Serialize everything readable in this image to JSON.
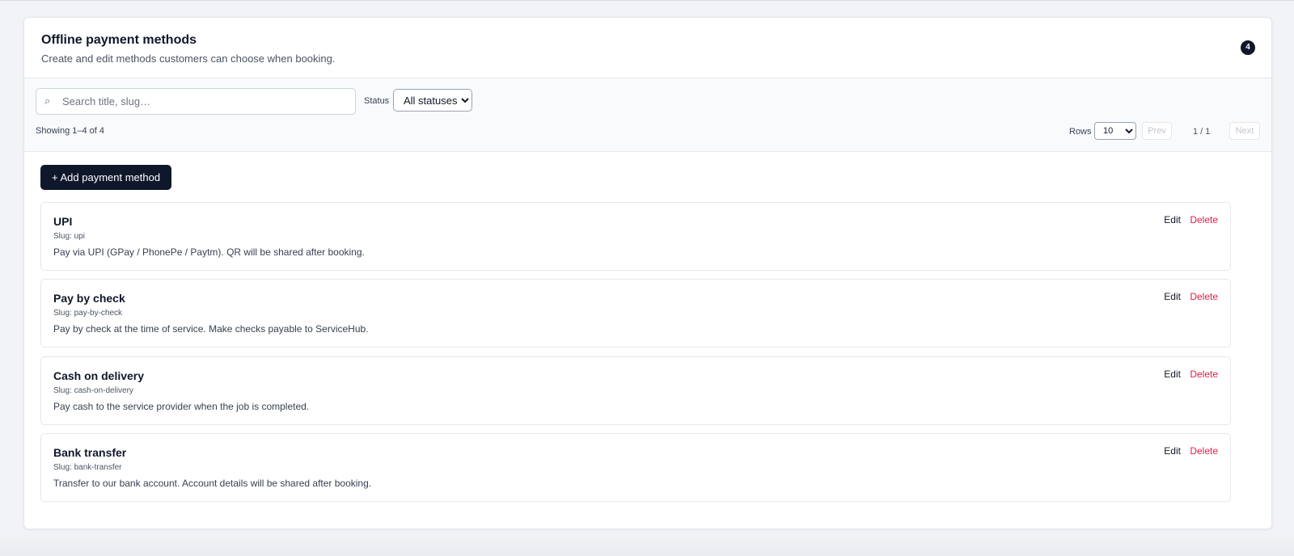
{
  "header": {
    "title": "Offline payment methods",
    "subtitle": "Create and edit methods customers can choose when booking.",
    "count_badge": "4"
  },
  "filters": {
    "search_placeholder": "Search title, slug…",
    "search_value": "",
    "status_label": "Status",
    "status_selected": "All statuses",
    "showing_text": "Showing 1–4 of 4",
    "rows_label": "Rows",
    "rows_selected": "10",
    "prev_label": "Prev",
    "page_indicator": "1 / 1",
    "next_label": "Next"
  },
  "actions": {
    "add_label": "+ Add payment method"
  },
  "methods": [
    {
      "title": "UPI",
      "slug": "Slug: upi",
      "description": "Pay via UPI (GPay / PhonePe / Paytm). QR will be shared after booking.",
      "edit_label": "Edit",
      "delete_label": "Delete"
    },
    {
      "title": "Pay by check",
      "slug": "Slug: pay-by-check",
      "description": "Pay by check at the time of service. Make checks payable to ServiceHub.",
      "edit_label": "Edit",
      "delete_label": "Delete"
    },
    {
      "title": "Cash on delivery",
      "slug": "Slug: cash-on-delivery",
      "description": "Pay cash to the service provider when the job is completed.",
      "edit_label": "Edit",
      "delete_label": "Delete"
    },
    {
      "title": "Bank transfer",
      "slug": "Slug: bank-transfer",
      "description": "Transfer to our bank account. Account details will be shared after booking.",
      "edit_label": "Edit",
      "delete_label": "Delete"
    }
  ],
  "icons": {
    "search": "search-icon"
  },
  "colors": {
    "primary": "#0f172a",
    "danger": "#e11d48"
  }
}
